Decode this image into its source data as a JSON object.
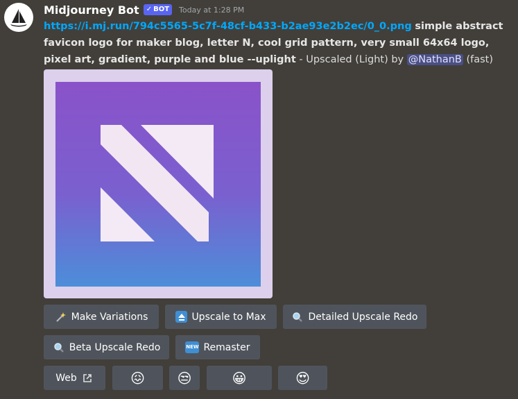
{
  "bot": {
    "name": "Midjourney Bot",
    "badge_label": "BOT",
    "timestamp": "Today at 1:28 PM"
  },
  "message": {
    "link": "https://i.mj.run/794c5565-5c7f-48cf-b433-b2ae93e2b2ec/0_0.png",
    "prompt": "simple abstract favicon logo for maker blog, letter N, cool grid pattern, very small 64x64 logo, pixel art, gradient, purple and blue --uplight",
    "suffix": "- Upscaled (Light) by",
    "mention": "@NathanB",
    "speed": "(fast)"
  },
  "image": {
    "colors": {
      "top": "#8a4fc8",
      "mid": "#7a5fd0",
      "bottom": "#4a8ad8",
      "frame": "#ddd0ec",
      "letter": "#f3e8f4"
    }
  },
  "buttons": {
    "row1": [
      {
        "label": "Make Variations",
        "icon": "sparkles-icon"
      },
      {
        "label": "Upscale to Max",
        "icon": "upscale-arrow-icon"
      },
      {
        "label": "Detailed Upscale Redo",
        "icon": "magnifier-icon"
      }
    ],
    "row2": [
      {
        "label": "Beta Upscale Redo",
        "icon": "magnifier-icon"
      },
      {
        "label": "Remaster",
        "icon": "new-icon",
        "icon_text": "NEW"
      }
    ],
    "row3": [
      {
        "label": "Web",
        "icon": "external-link-icon"
      },
      {
        "label": "",
        "icon": "confounded-face-emoji",
        "glyph": "😖"
      },
      {
        "label": "",
        "icon": "unamused-face-emoji",
        "glyph": "😒"
      },
      {
        "label": "",
        "icon": "smiling-face-emoji",
        "glyph": "😀"
      },
      {
        "label": "",
        "icon": "heart-eyes-emoji",
        "glyph": "😍"
      }
    ]
  },
  "colors": {
    "background": "#423f3a",
    "button": "#4f545c",
    "link": "#00a8fc",
    "bot_badge": "#5865f2"
  }
}
